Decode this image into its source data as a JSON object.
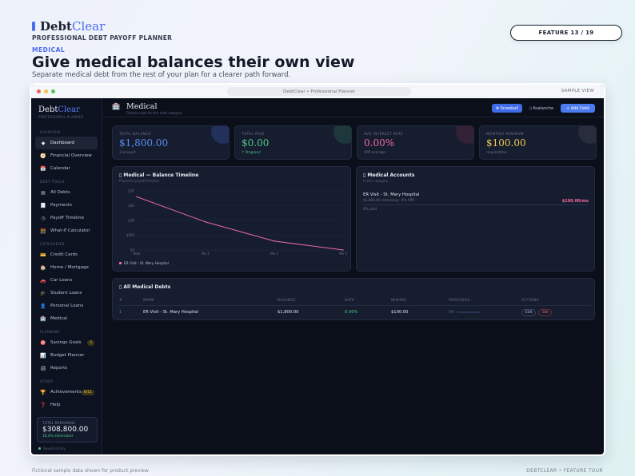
{
  "header": {
    "brand_main": "Debt",
    "brand_accent": "Clear",
    "tagline": "PROFESSIONAL DEBT PAYOFF PLANNER",
    "feature_pill": "FEATURE 13 / 19",
    "section_tag": "MEDICAL",
    "title": "Give medical balances their own view",
    "subtitle": "Separate medical debt from the rest of your plan for a clearer path forward."
  },
  "window": {
    "url": "DebtClear  •  Professional Planner",
    "sample_label": "SAMPLE VIEW",
    "dot_colors": [
      "#f0605c",
      "#f3be4e",
      "#57c35a"
    ]
  },
  "sidebar": {
    "brand_main": "Debt",
    "brand_accent": "Clear",
    "brand_sub": "PROFESSIONAL PLANNER",
    "sections": {
      "overview": "OVERVIEW",
      "debt_tools": "DEBT TOOLS",
      "categories": "CATEGORIES",
      "planning": "PLANNING",
      "other": "OTHER"
    },
    "items": {
      "dashboard": {
        "label": "Dashboard",
        "icon": "◆"
      },
      "financial_overview": {
        "label": "Financial Overview",
        "icon": "🧭"
      },
      "calendar": {
        "label": "Calendar",
        "icon": "📅"
      },
      "all_debts": {
        "label": "All Debts",
        "icon": "▤"
      },
      "payments": {
        "label": "Payments",
        "icon": "🧾"
      },
      "payoff_timeline": {
        "label": "Payoff Timeline",
        "icon": "◷"
      },
      "what_if": {
        "label": "What-If Calculator",
        "icon": "🧮"
      },
      "credit_cards": {
        "label": "Credit Cards",
        "icon": "💳"
      },
      "home_mortgage": {
        "label": "Home / Mortgage",
        "icon": "🏠"
      },
      "car_loans": {
        "label": "Car Loans",
        "icon": "🚗"
      },
      "student_loans": {
        "label": "Student Loans",
        "icon": "🎓"
      },
      "personal_loans": {
        "label": "Personal Loans",
        "icon": "👤"
      },
      "medical": {
        "label": "Medical",
        "icon": "🏥"
      },
      "savings_goals": {
        "label": "Savings Goals",
        "icon": "🎯",
        "badge": "3"
      },
      "budget_planner": {
        "label": "Budget Planner",
        "icon": "📊"
      },
      "reports": {
        "label": "Reports",
        "icon": "🖨"
      },
      "achievements": {
        "label": "Achievements",
        "icon": "🏆",
        "badge": "6/11"
      },
      "help": {
        "label": "Help",
        "icon": "❓"
      }
    },
    "total": {
      "label": "TOTAL REMAINING",
      "value": "$308,800.00",
      "pct": "18.4% eliminated"
    },
    "saved": "Saved locally"
  },
  "topbar": {
    "icon": "🏥",
    "title": "Medical",
    "subtitle": "Filtered view for this debt category",
    "snowball": "❄ Snowball",
    "avalanche": "▯ Avalanche",
    "add_debt": "+ Add Debt"
  },
  "stats": [
    {
      "label": "TOTAL BALANCE",
      "value": "$1,800.00",
      "sub": "1 account",
      "color": "#5b8cf5"
    },
    {
      "label": "TOTAL PAID",
      "value": "$0.00",
      "sub": "↑ Progress!",
      "color": "#4ecb8a"
    },
    {
      "label": "AVG INTEREST RATE",
      "value": "0.00%",
      "sub": "APR average",
      "color": "#f06aa0"
    },
    {
      "label": "MONTHLY MINIMUM",
      "value": "$100.00",
      "sub": "required/mo",
      "color": "#f0c85a"
    }
  ],
  "timeline": {
    "title": "▯ Medical — Balance Timeline",
    "subtitle": "Projected payoff timeline"
  },
  "accounts": {
    "title": "▯ Medical Accounts",
    "subtitle": "In this category",
    "items": [
      {
        "name": "ER Visit - St. Mary Hospital",
        "meta": "$1,800.00 remaining · 0% APR",
        "amount": "$100.00/mo",
        "paid": "0% paid"
      }
    ]
  },
  "debts_table": {
    "title": "▯ All Medical Debts",
    "headers": [
      "#",
      "NAME",
      "BALANCE",
      "RATE",
      "MIN/MO",
      "PROGRESS",
      "ACTIONS"
    ],
    "rows": [
      {
        "num": "1",
        "name": "ER Visit - St. Mary Hospital",
        "balance": "$1,800.00",
        "rate": "0.00%",
        "min": "$100.00",
        "progress": "0%",
        "edit": "Edit",
        "del": "Del"
      }
    ]
  },
  "chart_data": {
    "type": "line",
    "title": "",
    "xlabel": "",
    "ylabel": "",
    "categories": [
      "Now",
      "Mo 1",
      "Mo 2",
      "Mo 3"
    ],
    "y_ticks": [
      "$0",
      "$500",
      "$1K",
      "$2K",
      "$2K"
    ],
    "ylim": [
      0,
      2000
    ],
    "series": [
      {
        "name": "ER Visit - St. Mary Hospital",
        "values": [
          1800,
          950,
          300,
          0
        ],
        "color": "#e86ba8"
      }
    ],
    "legend": "bottom-left",
    "grid": true
  },
  "footer": {
    "left": "Fictional sample data shown for product preview",
    "right": "DEBTCLEAR  •  FEATURE TOUR"
  }
}
